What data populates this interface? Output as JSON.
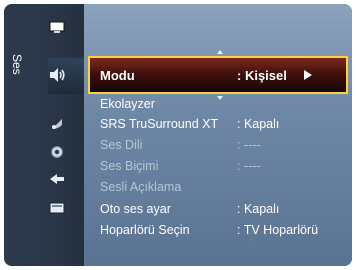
{
  "sidebar": {
    "label": "Ses",
    "icons": [
      "picture-icon",
      "sound-icon",
      "channel-icon",
      "setup-icon",
      "input-icon",
      "application-icon"
    ]
  },
  "menu": {
    "selected": {
      "label": "Modu",
      "value": ": Kişisel"
    },
    "items": [
      {
        "label": "Ekolayzer",
        "value": ""
      },
      {
        "label": "SRS TruSurround XT",
        "value": ": Kapalı"
      },
      {
        "label": "Ses Dili",
        "value": ": ----"
      },
      {
        "label": "Ses Biçimi",
        "value": ": ----"
      },
      {
        "label": "Sesli Açıklama",
        "value": ""
      },
      {
        "label": "Oto ses ayar",
        "value": ": Kapalı"
      },
      {
        "label": "Hoparlörü Seçin",
        "value": ": TV Hoparlörü"
      }
    ]
  },
  "colors": {
    "highlight_border": "#ffd23a",
    "text": "#ffffff",
    "disabled_text": "#b8c6d6"
  }
}
